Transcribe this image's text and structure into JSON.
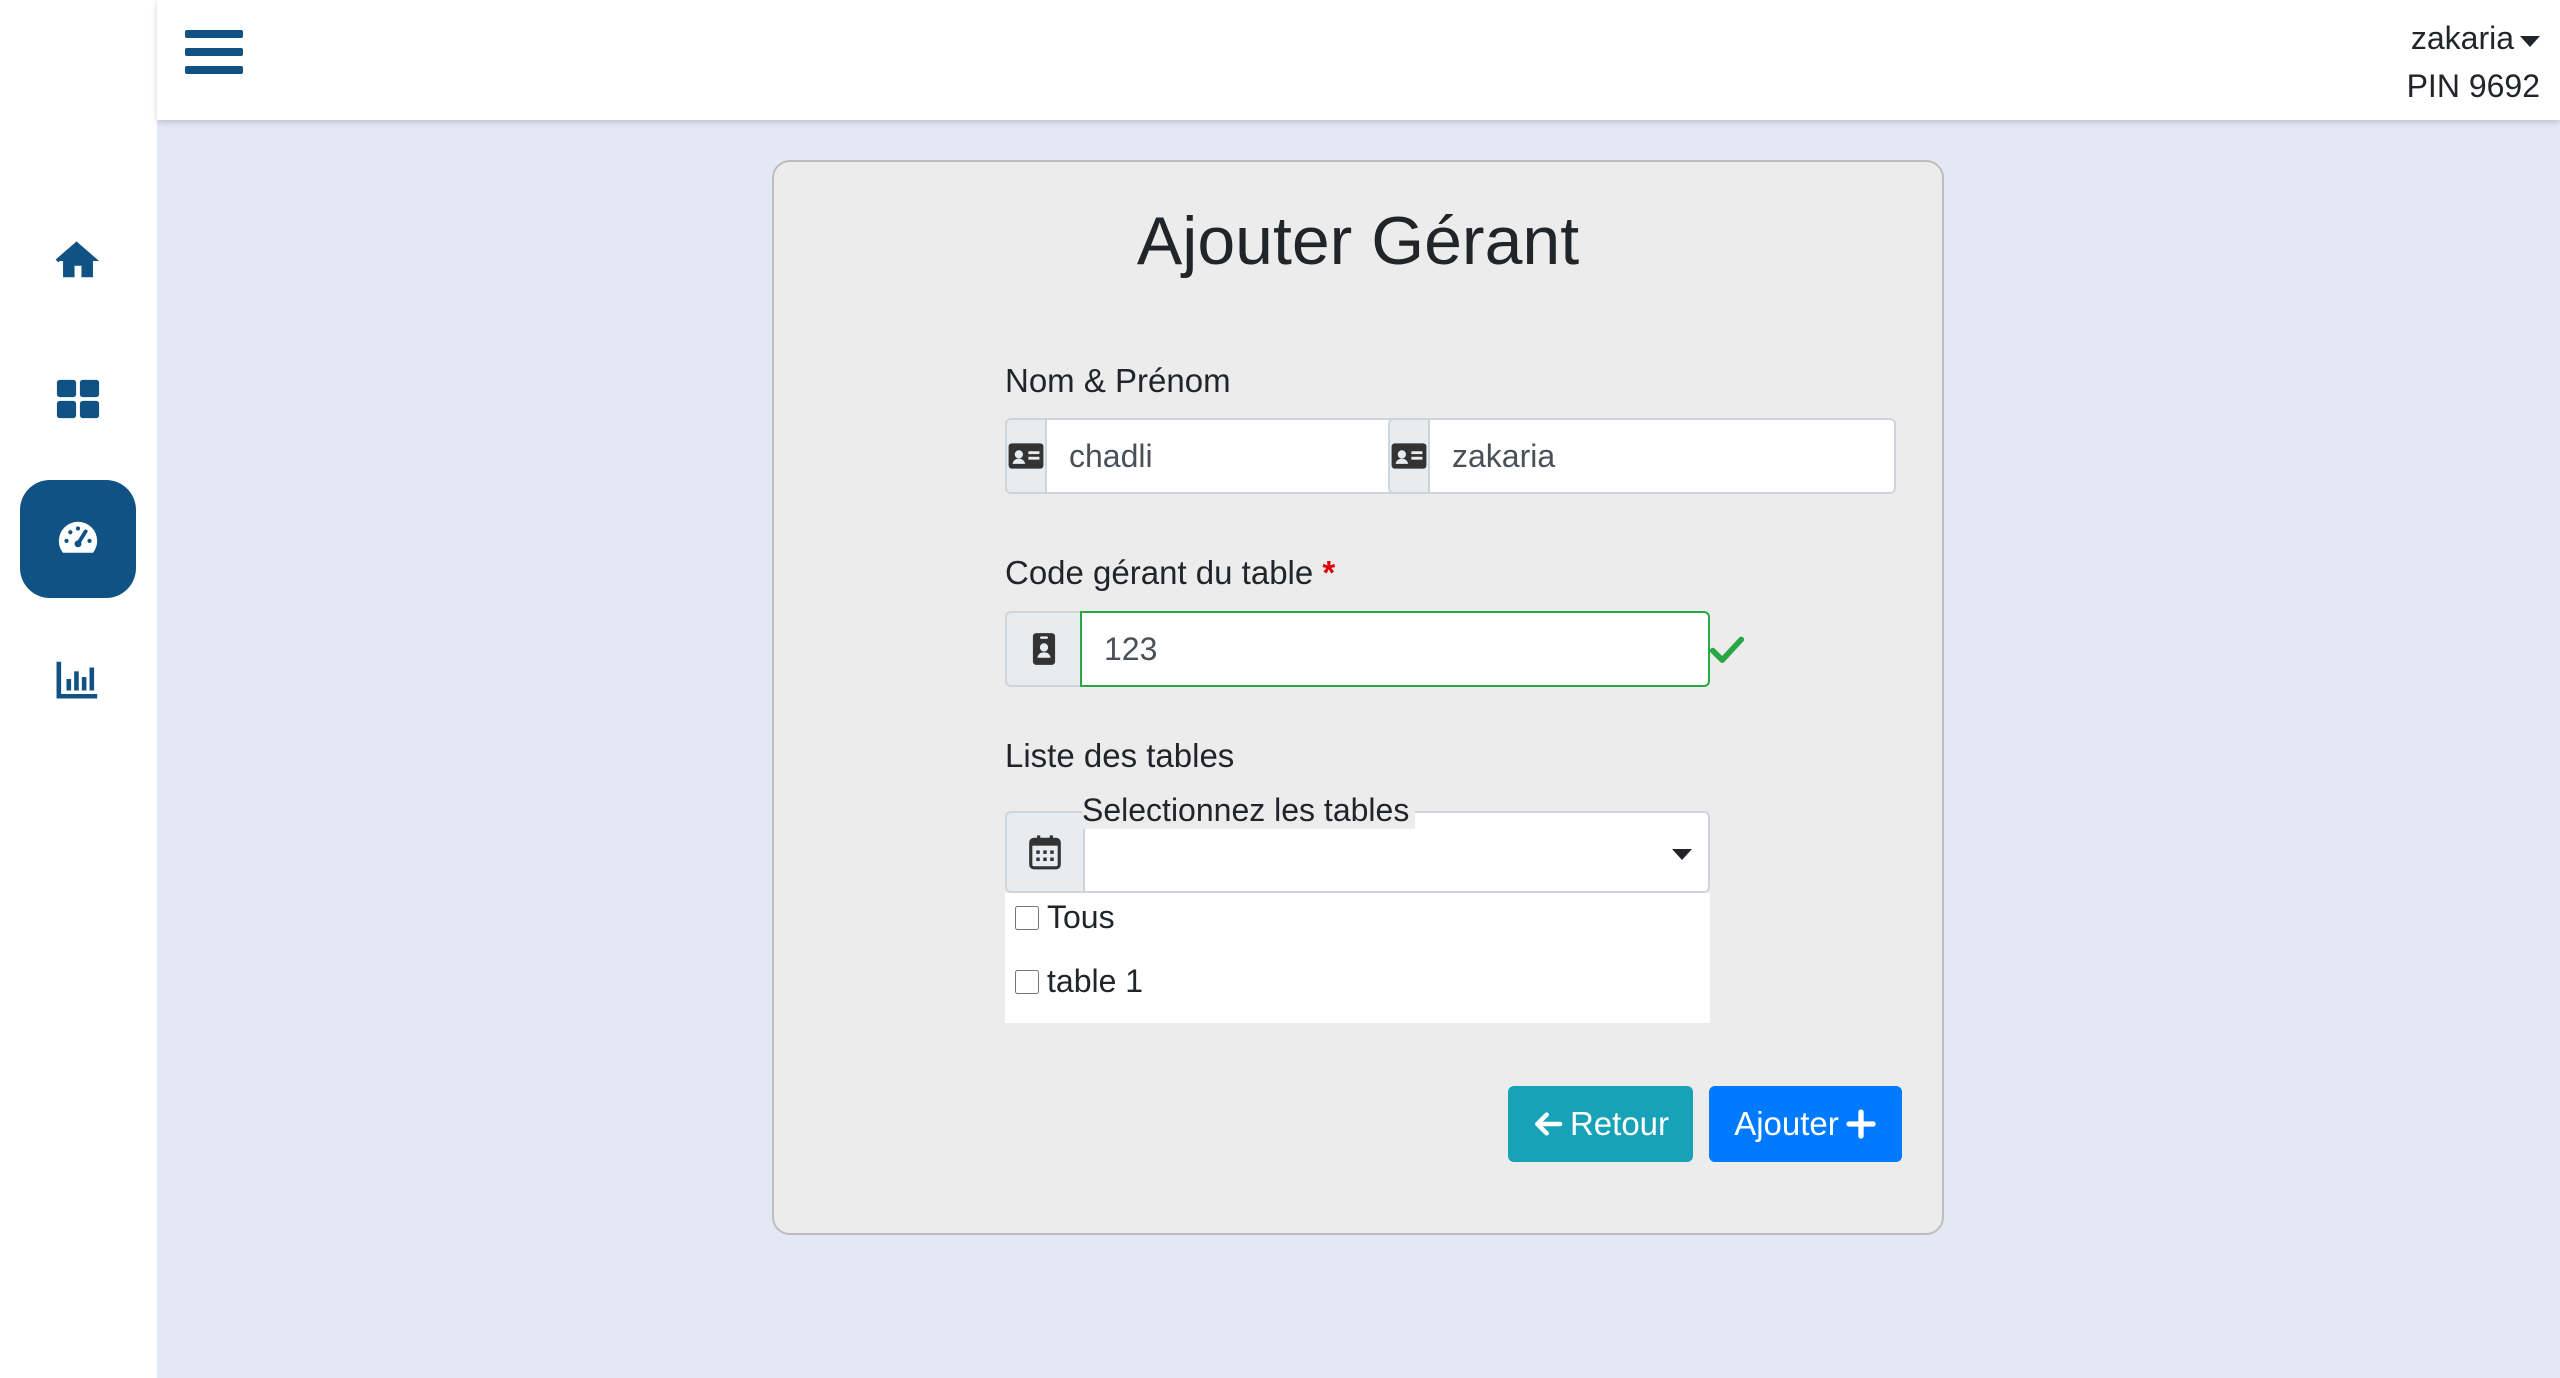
{
  "sidebar": {
    "items": [
      {
        "icon": "home-icon",
        "active": false
      },
      {
        "icon": "grid-icon",
        "active": false
      },
      {
        "icon": "dashboard-gauge-icon",
        "active": true
      },
      {
        "icon": "bar-chart-icon",
        "active": false
      }
    ]
  },
  "header": {
    "user_name": "zakaria",
    "pin": "PIN 9692"
  },
  "form": {
    "title": "Ajouter Gérant",
    "name_label": "Nom & Prénom",
    "last_name_value": "chadli",
    "first_name_value": "zakaria",
    "code_label": "Code gérant du table",
    "code_required_mark": "*",
    "code_value": "123",
    "tables_label": "Liste des tables",
    "tables_placeholder": "Selectionnez les tables",
    "tables_options": [
      {
        "label": "Tous",
        "checked": false
      },
      {
        "label": "table 1",
        "checked": false
      }
    ],
    "back_button": "Retour",
    "submit_button": "Ajouter"
  },
  "colors": {
    "primary_dark": "#0f5283",
    "background": "#e3e8f4",
    "card": "#ececec",
    "retour": "#17a2b8",
    "ajouter": "#007bff",
    "valid": "#28a745",
    "required": "#e0000b"
  }
}
